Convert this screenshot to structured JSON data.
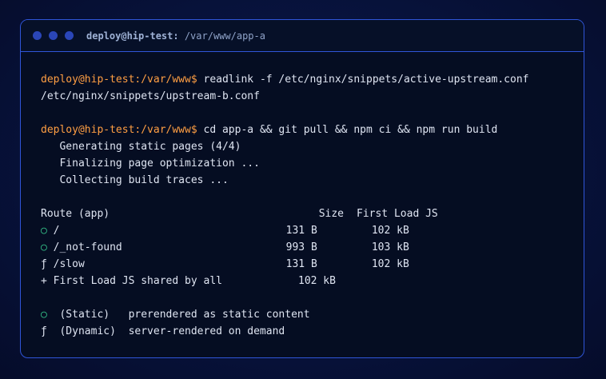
{
  "window": {
    "title": "deploy@hip-test: /var/www/app-a",
    "title_user": "deploy@hip-test:",
    "title_path": " /var/www/app-a"
  },
  "prompt": "deploy@hip-test:/var/www$",
  "commands": [
    {
      "cmd": " readlink -f /etc/nginx/snippets/active-upstream.conf",
      "output": [
        "/etc/nginx/snippets/upstream-b.conf"
      ]
    },
    {
      "cmd": " cd app-a && git pull && npm ci && npm run build",
      "output": [
        "   Generating static pages (4/4)",
        "   Finalizing page optimization ...",
        "   Collecting build traces ..."
      ]
    }
  ],
  "build_table": {
    "header": {
      "route": "Route (app)",
      "size": "Size",
      "first_load": "First Load JS"
    },
    "rows": [
      {
        "marker": "○",
        "route": "/",
        "size": "131 B",
        "first_load": "102 kB"
      },
      {
        "marker": "○",
        "route": "/_not-found",
        "size": "993 B",
        "first_load": "103 kB"
      },
      {
        "marker": "ƒ",
        "route": "/slow",
        "size": "131 B",
        "first_load": "102 kB"
      }
    ],
    "shared": {
      "label": "+ First Load JS shared by all",
      "size": "102 kB"
    }
  },
  "legend": [
    {
      "marker": "○",
      "text": "  (Static)   prerendered as static content"
    },
    {
      "marker": "ƒ",
      "text": "  (Dynamic)  server-rendered on demand"
    }
  ],
  "colors": {
    "accent_border": "#2f55d8",
    "prompt": "#ff9f43",
    "static_marker": "#36c98c"
  }
}
